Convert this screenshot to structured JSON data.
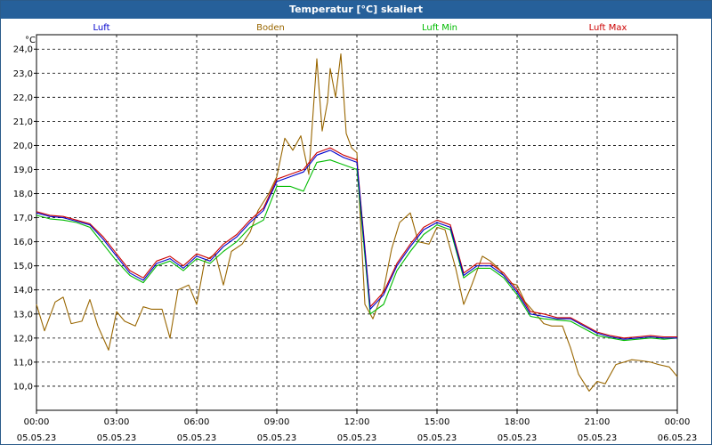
{
  "window": {
    "title": "Temperatur [°C] skaliert"
  },
  "chart_data": {
    "type": "line",
    "title": "Temperatur [°C] skaliert",
    "ylabel": "°C",
    "xlabel": "",
    "ylim": [
      9.0,
      24.6
    ],
    "xlim": [
      0,
      24
    ],
    "grid": true,
    "legend_position": "top",
    "y_ticks": [
      "10,0",
      "11,0",
      "12,0",
      "13,0",
      "14,0",
      "15,0",
      "16,0",
      "17,0",
      "18,0",
      "19,0",
      "20,0",
      "21,0",
      "22,0",
      "23,0",
      "24,0"
    ],
    "x_ticks": [
      {
        "x": 0,
        "time": "00:00",
        "date": "05.05.23"
      },
      {
        "x": 3,
        "time": "03:00",
        "date": "05.05.23"
      },
      {
        "x": 6,
        "time": "06:00",
        "date": "05.05.23"
      },
      {
        "x": 9,
        "time": "09:00",
        "date": "05.05.23"
      },
      {
        "x": 12,
        "time": "12:00",
        "date": "05.05.23"
      },
      {
        "x": 15,
        "time": "15:00",
        "date": "05.05.23"
      },
      {
        "x": 18,
        "time": "18:00",
        "date": "05.05.23"
      },
      {
        "x": 21,
        "time": "21:00",
        "date": "05.05.23"
      },
      {
        "x": 24,
        "time": "00:00",
        "date": "06.05.23"
      }
    ],
    "series": [
      {
        "name": "Luft",
        "color": "#0000cc",
        "x": [
          0,
          0.5,
          1,
          1.5,
          2,
          2.5,
          3,
          3.5,
          4,
          4.5,
          5,
          5.5,
          6,
          6.5,
          7,
          7.5,
          8,
          8.5,
          9,
          9.5,
          10,
          10.5,
          11,
          11.5,
          12,
          12.5,
          13,
          13.5,
          14,
          14.5,
          15,
          15.5,
          16,
          16.5,
          17,
          17.5,
          18,
          18.5,
          19,
          19.5,
          20,
          20.5,
          21,
          21.5,
          22,
          22.5,
          23,
          23.5,
          24
        ],
        "values": [
          17.2,
          17.05,
          17.0,
          16.85,
          16.7,
          16.1,
          15.4,
          14.7,
          14.4,
          15.1,
          15.3,
          14.9,
          15.4,
          15.2,
          15.8,
          16.2,
          16.8,
          17.3,
          18.5,
          18.7,
          18.9,
          19.6,
          19.8,
          19.5,
          19.3,
          13.2,
          13.8,
          15.0,
          15.8,
          16.5,
          16.8,
          16.6,
          14.6,
          15.0,
          15.0,
          14.6,
          13.9,
          13.0,
          12.9,
          12.8,
          12.8,
          12.5,
          12.2,
          12.05,
          11.95,
          12.0,
          12.05,
          12.0,
          12.0
        ]
      },
      {
        "name": "Boden",
        "color": "#996600",
        "x": [
          0,
          0.3,
          0.7,
          1,
          1.3,
          1.7,
          2,
          2.3,
          2.7,
          3,
          3.3,
          3.7,
          4,
          4.3,
          4.7,
          5,
          5.3,
          5.7,
          6,
          6.3,
          6.7,
          7,
          7.3,
          7.7,
          8,
          8.3,
          8.7,
          9,
          9.3,
          9.6,
          9.9,
          10.2,
          10.5,
          10.7,
          10.9,
          11.0,
          11.2,
          11.4,
          11.6,
          11.8,
          12.0,
          12.3,
          12.6,
          13,
          13.3,
          13.6,
          14,
          14.3,
          14.7,
          15,
          15.3,
          15.7,
          16,
          16.3,
          16.7,
          17,
          17.3,
          17.7,
          18,
          18.3,
          18.7,
          19,
          19.3,
          19.7,
          20,
          20.3,
          20.7,
          21,
          21.3,
          21.7,
          22,
          22.3,
          22.7,
          23,
          23.3,
          23.7,
          24
        ],
        "values": [
          13.4,
          12.3,
          13.5,
          13.7,
          12.6,
          12.7,
          13.6,
          12.5,
          11.5,
          13.1,
          12.7,
          12.5,
          13.3,
          13.2,
          13.2,
          12.0,
          14.0,
          14.2,
          13.4,
          15.2,
          15.5,
          14.2,
          15.6,
          15.9,
          16.4,
          17.3,
          18.0,
          18.7,
          20.3,
          19.8,
          20.4,
          18.8,
          23.6,
          20.6,
          21.8,
          23.2,
          22.0,
          23.8,
          20.5,
          19.9,
          19.7,
          13.4,
          12.8,
          14.0,
          15.7,
          16.8,
          17.2,
          16.0,
          15.9,
          16.6,
          16.5,
          14.9,
          13.4,
          14.2,
          15.4,
          15.2,
          14.9,
          14.3,
          14.2,
          13.5,
          13.0,
          12.6,
          12.5,
          12.5,
          11.6,
          10.5,
          9.8,
          10.2,
          10.1,
          10.9,
          11.0,
          11.1,
          11.05,
          11.0,
          10.9,
          10.8,
          10.4
        ]
      },
      {
        "name": "Luft Min",
        "color": "#00bb00",
        "x": [
          0,
          0.5,
          1,
          1.5,
          2,
          2.5,
          3,
          3.5,
          4,
          4.5,
          5,
          5.5,
          6,
          6.5,
          7,
          7.5,
          8,
          8.5,
          9,
          9.5,
          10,
          10.5,
          11,
          11.5,
          12,
          12.5,
          13,
          13.5,
          14,
          14.5,
          15,
          15.5,
          16,
          16.5,
          17,
          17.5,
          18,
          18.5,
          19,
          19.5,
          20,
          20.5,
          21,
          21.5,
          22,
          22.5,
          23,
          23.5,
          24
        ],
        "values": [
          17.1,
          16.95,
          16.9,
          16.8,
          16.6,
          15.9,
          15.2,
          14.6,
          14.3,
          15.0,
          15.2,
          14.8,
          15.3,
          15.1,
          15.6,
          16.0,
          16.6,
          16.9,
          18.3,
          18.3,
          18.1,
          19.3,
          19.4,
          19.2,
          19.0,
          13.0,
          13.4,
          14.8,
          15.6,
          16.3,
          16.7,
          16.5,
          14.5,
          14.9,
          14.9,
          14.5,
          13.8,
          12.9,
          12.8,
          12.75,
          12.7,
          12.4,
          12.1,
          12.0,
          11.9,
          11.95,
          12.0,
          11.95,
          12.0
        ]
      },
      {
        "name": "Luft Max",
        "color": "#cc0000",
        "x": [
          0,
          0.5,
          1,
          1.5,
          2,
          2.5,
          3,
          3.5,
          4,
          4.5,
          5,
          5.5,
          6,
          6.5,
          7,
          7.5,
          8,
          8.5,
          9,
          9.5,
          10,
          10.5,
          11,
          11.5,
          12,
          12.5,
          13,
          13.5,
          14,
          14.5,
          15,
          15.5,
          16,
          16.5,
          17,
          17.5,
          18,
          18.5,
          19,
          19.5,
          20,
          20.5,
          21,
          21.5,
          22,
          22.5,
          23,
          23.5,
          24
        ],
        "values": [
          17.25,
          17.1,
          17.05,
          16.9,
          16.75,
          16.2,
          15.5,
          14.8,
          14.5,
          15.2,
          15.4,
          15.0,
          15.5,
          15.3,
          15.9,
          16.3,
          16.9,
          17.4,
          18.6,
          18.8,
          19.0,
          19.7,
          19.9,
          19.6,
          19.4,
          13.3,
          13.9,
          15.1,
          15.9,
          16.6,
          16.9,
          16.7,
          14.7,
          15.1,
          15.1,
          14.7,
          14.0,
          13.1,
          13.0,
          12.85,
          12.85,
          12.55,
          12.25,
          12.1,
          12.0,
          12.05,
          12.1,
          12.05,
          12.05
        ]
      }
    ]
  }
}
